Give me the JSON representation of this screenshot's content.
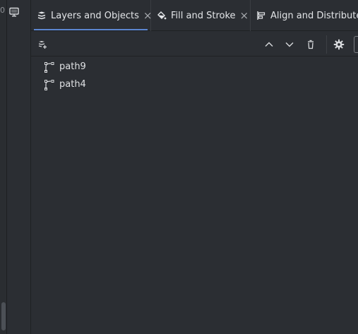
{
  "left_strip": {
    "edge_glyph": "0"
  },
  "dock": {
    "monitor_icon": "monitor-icon"
  },
  "tabs": [
    {
      "label": "Layers and Objects",
      "icon": "layers-icon",
      "closable": true,
      "active": true
    },
    {
      "label": "Fill and Stroke",
      "icon": "paint-bucket-icon",
      "closable": true,
      "active": false
    },
    {
      "label": "Align and Distribute",
      "icon": "align-icon",
      "closable": false,
      "active": false
    }
  ],
  "close_glyph": "×",
  "toolbar": {
    "buttons": [
      "add-layer-icon",
      "move-up-icon",
      "move-down-icon",
      "delete-icon",
      "settings-icon"
    ]
  },
  "tree": {
    "items": [
      {
        "label": "path9",
        "icon": "path-icon"
      },
      {
        "label": "path4",
        "icon": "path-icon"
      }
    ]
  },
  "colors": {
    "background": "#2b2e33",
    "accent": "#5c86d1",
    "text": "#e3e5e8"
  }
}
